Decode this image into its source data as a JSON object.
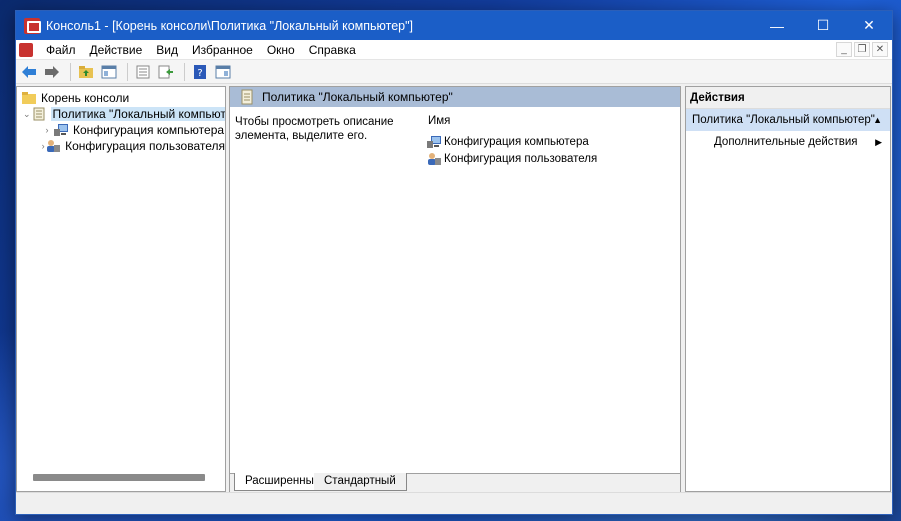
{
  "window": {
    "title": "Консоль1 - [Корень консоли\\Политика \"Локальный компьютер\"]",
    "controls": {
      "minimize": "—",
      "maximize": "☐",
      "close": "✕"
    }
  },
  "menu": {
    "items": [
      "Файл",
      "Действие",
      "Вид",
      "Избранное",
      "Окно",
      "Справка"
    ],
    "mdi": {
      "minimize": "_",
      "restore": "❐",
      "close": "✕"
    }
  },
  "toolbar": {
    "icons": [
      "back-arrow-icon",
      "forward-arrow-icon",
      "up-folder-icon",
      "show-hide-tree-icon",
      "properties-icon",
      "export-list-icon",
      "help-icon",
      "show-hide-actions-icon"
    ]
  },
  "tree": {
    "root": "Корень консоли",
    "policy": "Политика \"Локальный компьютер\"",
    "children": [
      "Конфигурация компьютера",
      "Конфигурация пользователя"
    ],
    "collapse_glyph": "⌄",
    "expand_glyph": "›"
  },
  "center": {
    "header": "Политика \"Локальный компьютер\"",
    "description": "Чтобы просмотреть описание элемента, выделите его.",
    "column_name": "Имя",
    "rows": [
      "Конфигурация компьютера",
      "Конфигурация пользователя"
    ],
    "tabs": [
      "Расширенный",
      "Стандартный"
    ]
  },
  "actions": {
    "title": "Действия",
    "section": "Политика \"Локальный компьютер\"",
    "section_arrow": "▲",
    "item": "Дополнительные действия",
    "item_arrow": "▶"
  },
  "colors": {
    "titlebar": "#1b5ec7",
    "selection": "#cce4f7",
    "header": "#a9bcd6"
  }
}
